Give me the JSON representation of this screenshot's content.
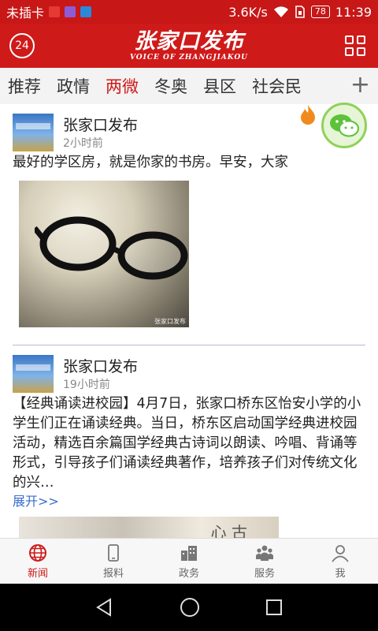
{
  "status_bar": {
    "carrier": "未插卡",
    "speed": "3.6K/s",
    "battery": "78",
    "time": "11:39"
  },
  "header": {
    "badge": "24",
    "logo_cn": "张家口发布",
    "logo_en": "VOICE OF ZHANGJIAKOU",
    "brand_color": "#cf1a1a"
  },
  "tabs": [
    {
      "label": "推荐"
    },
    {
      "label": "政情"
    },
    {
      "label": "两微",
      "active": true
    },
    {
      "label": "冬奥"
    },
    {
      "label": "县区"
    },
    {
      "label": "社会民"
    }
  ],
  "add_tab": "+",
  "feed": [
    {
      "author": "张家口发布",
      "time": "2小时前",
      "text": "最好的学区房，就是你家的书房。早安，大家",
      "image_watermark": "张家口发布"
    },
    {
      "author": "张家口发布",
      "time": "19小时前",
      "text": "【经典诵读进校园】4月7日，张家口桥东区怡安小学的小学生们正在诵读经典。当日，桥东区启动国学经典进校园活动，精选百余篇国学经典古诗词以朗读、吟唱、背诵等形式，引导孩子们诵读经典著作，培养孩子们对传统文化的兴…",
      "expand": "展开>>",
      "image_text": "心 古"
    }
  ],
  "bottom_nav": [
    {
      "label": "新闻",
      "icon": "globe-icon",
      "active": true
    },
    {
      "label": "报料",
      "icon": "phone-icon"
    },
    {
      "label": "政务",
      "icon": "building-icon"
    },
    {
      "label": "服务",
      "icon": "people-icon"
    },
    {
      "label": "我",
      "icon": "person-icon"
    }
  ]
}
